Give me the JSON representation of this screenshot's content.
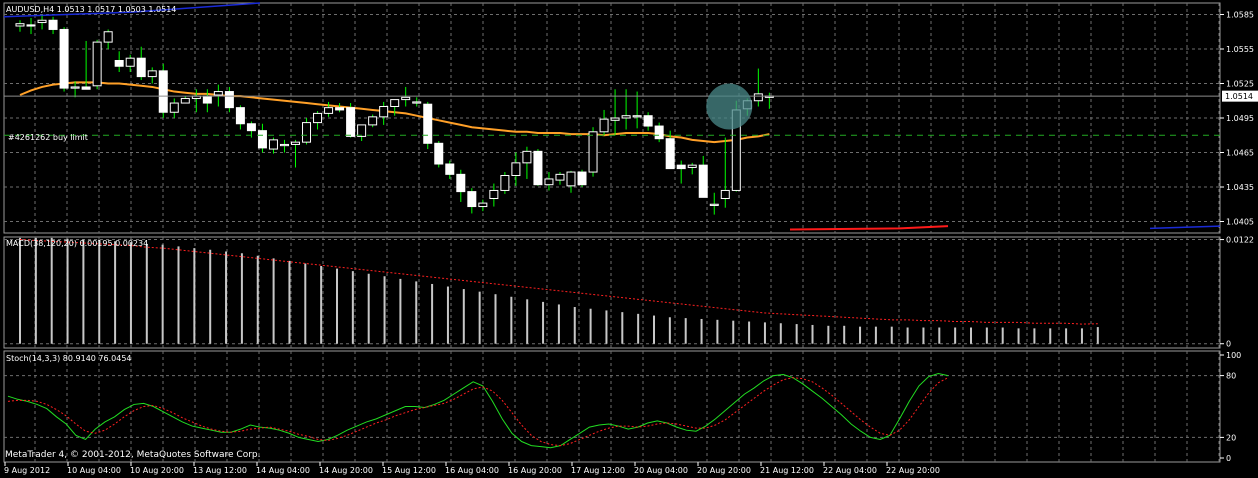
{
  "window": {
    "symbol_header": "AUDUSD,H4  1.0513 1.0517 1.0503 1.0514",
    "order_label": "#4261262 buy limit",
    "current_price_tag": "1.0514",
    "copyright": "MetaTrader 4, © 2001-2012, MetaQuotes Software Corp."
  },
  "colors": {
    "background": "#000000",
    "grid": "#6e6e6e",
    "candle_bull": "#000000",
    "candle_bear": "#ffffff",
    "candle_outline": "#ffffff",
    "wick": "#00ff00",
    "ma_orange": "#ffa028",
    "ma_blue": "#1a2bd8",
    "ma_red": "#ff1a1a",
    "macd_hist": "#c8c8c8",
    "macd_signal": "#ff2020",
    "stoch_main": "#22dd22",
    "stoch_signal": "#ff2020",
    "order_line": "#22aa22",
    "highlight": "#4a8a8a"
  },
  "chart_data": [
    {
      "type": "candlestick",
      "name": "price",
      "title": "AUDUSD,H4",
      "ylim": [
        1.0395,
        1.0595
      ],
      "yticks": [
        "1.0585",
        "1.0555",
        "1.0525",
        "1.0495",
        "1.0465",
        "1.0435",
        "1.0405"
      ],
      "ytick_values": [
        1.0585,
        1.0555,
        1.0525,
        1.0495,
        1.0465,
        1.0435,
        1.0405
      ],
      "current_price": 1.0514,
      "order_price": 1.048,
      "candles": [
        [
          1.0575,
          1.058,
          1.057,
          1.0577
        ],
        [
          1.0576,
          1.0582,
          1.0568,
          1.0575
        ],
        [
          1.0578,
          1.0584,
          1.0572,
          1.058
        ],
        [
          1.058,
          1.0583,
          1.0568,
          1.0572
        ],
        [
          1.0572,
          1.0574,
          1.0518,
          1.0521
        ],
        [
          1.0521,
          1.0527,
          1.0513,
          1.0522
        ],
        [
          1.0522,
          1.0562,
          1.052,
          1.052
        ],
        [
          1.0523,
          1.0563,
          1.052,
          1.0561
        ],
        [
          1.0561,
          1.0572,
          1.0555,
          1.057
        ],
        [
          1.0545,
          1.0553,
          1.0535,
          1.054
        ],
        [
          1.054,
          1.055,
          1.0535,
          1.0547
        ],
        [
          1.0547,
          1.0557,
          1.0528,
          1.0531
        ],
        [
          1.0531,
          1.0539,
          1.0525,
          1.0536
        ],
        [
          1.0536,
          1.0542,
          1.0495,
          1.05
        ],
        [
          1.05,
          1.0512,
          1.0495,
          1.0508
        ],
        [
          1.0508,
          1.0514,
          1.0508,
          1.0512
        ],
        [
          1.0512,
          1.052,
          1.05,
          1.0514
        ],
        [
          1.0514,
          1.052,
          1.05,
          1.0508
        ],
        [
          1.0515,
          1.0524,
          1.0505,
          1.0518
        ],
        [
          1.0518,
          1.0522,
          1.05,
          1.0504
        ],
        [
          1.0504,
          1.0506,
          1.0485,
          1.049
        ],
        [
          1.049,
          1.0492,
          1.0478,
          1.0484
        ],
        [
          1.0484,
          1.049,
          1.0465,
          1.0469
        ],
        [
          1.0468,
          1.0478,
          1.0464,
          1.0476
        ],
        [
          1.0472,
          1.0476,
          1.0465,
          1.0472
        ],
        [
          1.0472,
          1.0476,
          1.0452,
          1.0474
        ],
        [
          1.0474,
          1.0495,
          1.0472,
          1.0491
        ],
        [
          1.0491,
          1.0501,
          1.0485,
          1.0499
        ],
        [
          1.0499,
          1.0509,
          1.0496,
          1.0504
        ],
        [
          1.0504,
          1.0508,
          1.05,
          1.0502
        ],
        [
          1.0504,
          1.0508,
          1.0478,
          1.0479
        ],
        [
          1.0479,
          1.0484,
          1.0475,
          1.0489
        ],
        [
          1.0489,
          1.0498,
          1.0487,
          1.0496
        ],
        [
          1.0496,
          1.0509,
          1.0489,
          1.0505
        ],
        [
          1.0505,
          1.051,
          1.0497,
          1.0511
        ],
        [
          1.0511,
          1.0522,
          1.0505,
          1.0513
        ],
        [
          1.0509,
          1.0513,
          1.0505,
          1.0509
        ],
        [
          1.0507,
          1.0509,
          1.0468,
          1.0473
        ],
        [
          1.0473,
          1.0475,
          1.0452,
          1.0455
        ],
        [
          1.0455,
          1.0458,
          1.0442,
          1.0446
        ],
        [
          1.0446,
          1.045,
          1.0422,
          1.0431
        ],
        [
          1.0431,
          1.0434,
          1.0412,
          1.0418
        ],
        [
          1.0418,
          1.0424,
          1.0414,
          1.0421
        ],
        [
          1.0425,
          1.0438,
          1.0418,
          1.0432
        ],
        [
          1.0432,
          1.0448,
          1.0429,
          1.0445
        ],
        [
          1.0445,
          1.0465,
          1.0436,
          1.0456
        ],
        [
          1.0456,
          1.047,
          1.0442,
          1.0466
        ],
        [
          1.0466,
          1.0468,
          1.0436,
          1.0437
        ],
        [
          1.0437,
          1.0448,
          1.0432,
          1.0442
        ],
        [
          1.0441,
          1.0448,
          1.0437,
          1.0446
        ],
        [
          1.0436,
          1.0449,
          1.043,
          1.0448
        ],
        [
          1.0448,
          1.045,
          1.0435,
          1.0437
        ],
        [
          1.0448,
          1.0487,
          1.0444,
          1.0483
        ],
        [
          1.0483,
          1.0502,
          1.048,
          1.0494
        ],
        [
          1.0493,
          1.052,
          1.048,
          1.0495
        ],
        [
          1.0495,
          1.052,
          1.0485,
          1.0497
        ],
        [
          1.0497,
          1.0518,
          1.0486,
          1.0497
        ],
        [
          1.0497,
          1.05,
          1.0484,
          1.0488
        ],
        [
          1.0488,
          1.0491,
          1.0474,
          1.0477
        ],
        [
          1.0477,
          1.0484,
          1.0467,
          1.0451
        ],
        [
          1.0454,
          1.0458,
          1.0438,
          1.0451
        ],
        [
          1.0452,
          1.0456,
          1.0446,
          1.0454
        ],
        [
          1.0454,
          1.0462,
          1.0441,
          1.0426
        ],
        [
          1.042,
          1.043,
          1.0411,
          1.042
        ],
        [
          1.0425,
          1.0478,
          1.0417,
          1.0432
        ],
        [
          1.0432,
          1.051,
          1.0431,
          1.0502
        ],
        [
          1.0503,
          1.0512,
          1.0497,
          1.051
        ],
        [
          1.051,
          1.0538,
          1.0505,
          1.0516
        ],
        [
          1.0513,
          1.0517,
          1.0503,
          1.0514
        ]
      ],
      "ma_orange": [
        1.0515,
        1.0519,
        1.0522,
        1.0524,
        1.0525,
        1.0526,
        1.0526,
        1.0526,
        1.0525,
        1.0525,
        1.0524,
        1.0523,
        1.0522,
        1.052,
        1.0518,
        1.0517,
        1.0516,
        1.0516,
        1.0515,
        1.0514,
        1.0514,
        1.0513,
        1.0512,
        1.0511,
        1.051,
        1.0509,
        1.0508,
        1.0507,
        1.0506,
        1.0505,
        1.0504,
        1.0503,
        1.0502,
        1.0501,
        1.05,
        1.0499,
        1.0497,
        1.0495,
        1.0493,
        1.0491,
        1.0489,
        1.0487,
        1.0486,
        1.0485,
        1.0484,
        1.0483,
        1.0483,
        1.0482,
        1.0482,
        1.0482,
        1.0481,
        1.0481,
        1.0481,
        1.048,
        1.0481,
        1.0482,
        1.0482,
        1.0482,
        1.0481,
        1.0479,
        1.0478,
        1.0476,
        1.0475,
        1.0474,
        1.0475,
        1.0476,
        1.0478,
        1.0479,
        1.0481
      ]
    },
    {
      "type": "bar",
      "name": "macd",
      "title": "MACD(38,120,20) 0.00195 0.00234",
      "ylim": [
        -0.0005,
        0.0125
      ],
      "yticks": [
        "0.0122",
        "0"
      ],
      "ytick_values": [
        0.0122,
        0
      ],
      "histogram": [
        0.0124,
        0.0124,
        0.0124,
        0.0123,
        0.0122,
        0.0121,
        0.012,
        0.0119,
        0.0117,
        0.0116,
        0.0114,
        0.0112,
        0.011,
        0.0108,
        0.0106,
        0.0103,
        0.01,
        0.0097,
        0.0094,
        0.0091,
        0.0088,
        0.0085,
        0.0082,
        0.0079,
        0.0076,
        0.0073,
        0.007,
        0.0067,
        0.0064,
        0.0061,
        0.0058,
        0.0055,
        0.0052,
        0.0049,
        0.0046,
        0.0043,
        0.0041,
        0.0039,
        0.0037,
        0.0035,
        0.0033,
        0.0031,
        0.003,
        0.0029,
        0.0028,
        0.0027,
        0.0026,
        0.0025,
        0.0024,
        0.0023,
        0.0022,
        0.0021,
        0.0021,
        0.002,
        0.002,
        0.002,
        0.0019,
        0.0019,
        0.0019,
        0.0019,
        0.0019,
        0.0019,
        0.0019,
        0.0018,
        0.0018,
        0.0018,
        0.0018,
        0.0018,
        0.00195
      ],
      "signal": [
        0.0122,
        0.0121,
        0.012,
        0.0119,
        0.0118,
        0.0117,
        0.0116,
        0.0115,
        0.0113,
        0.0112,
        0.011,
        0.0108,
        0.0106,
        0.0104,
        0.0102,
        0.01,
        0.0098,
        0.0096,
        0.0094,
        0.0092,
        0.009,
        0.0088,
        0.0086,
        0.0084,
        0.0082,
        0.008,
        0.0078,
        0.0076,
        0.0074,
        0.0072,
        0.007,
        0.0068,
        0.0066,
        0.0064,
        0.0062,
        0.006,
        0.0058,
        0.0056,
        0.0054,
        0.0052,
        0.005,
        0.0048,
        0.0046,
        0.0044,
        0.0042,
        0.004,
        0.0038,
        0.0036,
        0.0035,
        0.0034,
        0.0033,
        0.0032,
        0.0031,
        0.003,
        0.0029,
        0.0028,
        0.0028,
        0.0027,
        0.0027,
        0.0026,
        0.0026,
        0.0025,
        0.0025,
        0.0025,
        0.0024,
        0.0024,
        0.0024,
        0.0023,
        0.00234
      ]
    },
    {
      "type": "line",
      "name": "stochastic",
      "title": "Stoch(14,3,3) 80.9140 76.0454",
      "ylim": [
        0,
        100
      ],
      "yticks": [
        "100",
        "80",
        "20",
        "0"
      ],
      "ytick_values": [
        100,
        80,
        20,
        0
      ],
      "main": [
        60,
        57,
        55,
        52,
        48,
        40,
        33,
        22,
        18,
        28,
        35,
        40,
        47,
        52,
        53,
        50,
        45,
        40,
        35,
        31,
        29,
        27,
        25,
        25,
        28,
        32,
        30,
        29,
        27,
        24,
        20,
        18,
        16,
        18,
        22,
        27,
        31,
        35,
        38,
        42,
        46,
        50,
        50,
        49,
        52,
        56,
        62,
        68,
        74,
        70,
        55,
        38,
        24,
        16,
        12,
        11,
        10,
        12,
        18,
        24,
        30,
        32,
        33,
        31,
        28,
        30,
        34,
        36,
        34,
        30,
        27,
        26,
        31,
        38,
        46,
        54,
        62,
        68,
        75,
        80,
        81,
        78,
        72,
        65,
        58,
        50,
        42,
        33,
        26,
        20,
        18,
        22,
        38,
        55,
        70,
        79,
        82,
        80
      ],
      "signal": [
        55,
        56,
        56,
        55,
        52,
        47,
        41,
        33,
        26,
        24,
        27,
        33,
        40,
        46,
        50,
        51,
        48,
        44,
        39,
        35,
        31,
        28,
        26,
        25,
        26,
        28,
        29,
        30,
        28,
        26,
        23,
        21,
        18,
        17,
        19,
        22,
        26,
        30,
        34,
        37,
        41,
        44,
        47,
        49,
        51,
        53,
        57,
        62,
        67,
        69,
        65,
        56,
        44,
        32,
        22,
        16,
        13,
        12,
        14,
        18,
        22,
        26,
        29,
        31,
        31,
        30,
        31,
        33,
        34,
        33,
        31,
        29,
        29,
        32,
        37,
        44,
        51,
        58,
        65,
        71,
        76,
        78,
        77,
        74,
        68,
        61,
        53,
        45,
        37,
        30,
        24,
        22,
        27,
        37,
        50,
        63,
        73,
        78
      ]
    }
  ],
  "xaxis": {
    "labels": [
      "9 Aug 2012",
      "10 Aug 04:00",
      "10 Aug 20:00",
      "13 Aug 12:00",
      "14 Aug 04:00",
      "14 Aug 20:00",
      "15 Aug 12:00",
      "16 Aug 04:00",
      "16 Aug 20:00",
      "17 Aug 12:00",
      "20 Aug 04:00",
      "20 Aug 20:00",
      "21 Aug 12:00",
      "22 Aug 04:00",
      "22 Aug 20:00"
    ]
  }
}
